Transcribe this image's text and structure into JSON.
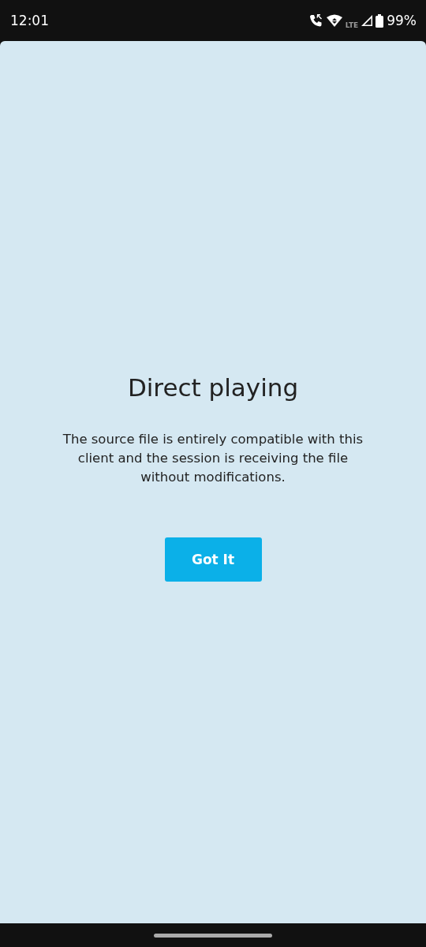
{
  "status_bar": {
    "time": "12:01",
    "network": "LTE",
    "battery": "99%"
  },
  "dialog": {
    "title": "Direct playing",
    "message": "The source file is entirely compatible with this client and the session is receiving the file without modifications.",
    "button": "Got It"
  }
}
